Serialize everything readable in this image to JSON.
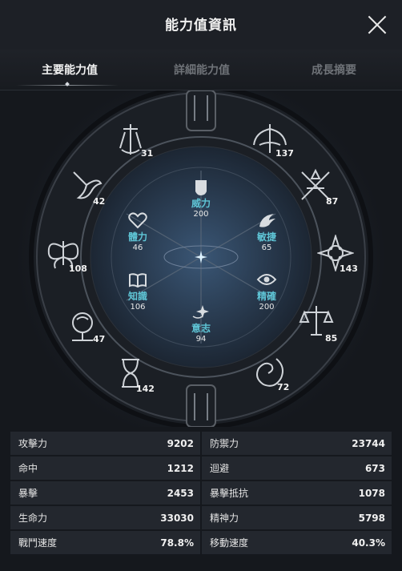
{
  "header": {
    "title": "能力值資訊"
  },
  "tabs": [
    {
      "label": "主要能力值",
      "active": true
    },
    {
      "label": "詳細能力值",
      "active": false
    },
    {
      "label": "成長摘要",
      "active": false
    }
  ],
  "wheel": {
    "outer": [
      {
        "icon": "sword-shield-icon",
        "value": "31"
      },
      {
        "icon": "winged-blade-icon",
        "value": "137"
      },
      {
        "icon": "phoenix-icon",
        "value": "42"
      },
      {
        "icon": "crossed-weapons-icon",
        "value": "87"
      },
      {
        "icon": "butterfly-icon",
        "value": "108"
      },
      {
        "icon": "star-compass-icon",
        "value": "143"
      },
      {
        "icon": "tree-icon",
        "value": "47"
      },
      {
        "icon": "scales-icon",
        "value": "85"
      },
      {
        "icon": "hourglass-icon",
        "value": "142"
      },
      {
        "icon": "swirl-icon",
        "value": "72"
      }
    ],
    "inner": [
      {
        "icon": "fist-icon",
        "label": "威力",
        "value": "200"
      },
      {
        "icon": "heart-icon",
        "label": "體力",
        "value": "46"
      },
      {
        "icon": "wing-icon",
        "label": "敏捷",
        "value": "65"
      },
      {
        "icon": "book-icon",
        "label": "知識",
        "value": "106"
      },
      {
        "icon": "eye-icon",
        "label": "精確",
        "value": "200"
      },
      {
        "icon": "shooting-star-icon",
        "label": "意志",
        "value": "94"
      }
    ]
  },
  "stats": [
    [
      {
        "label": "攻擊力",
        "value": "9202"
      },
      {
        "label": "防禦力",
        "value": "23744"
      }
    ],
    [
      {
        "label": "命中",
        "value": "1212"
      },
      {
        "label": "迴避",
        "value": "673"
      }
    ],
    [
      {
        "label": "暴擊",
        "value": "2453"
      },
      {
        "label": "暴擊抵抗",
        "value": "1078"
      }
    ],
    [
      {
        "label": "生命力",
        "value": "33030"
      },
      {
        "label": "精神力",
        "value": "5798"
      }
    ],
    [
      {
        "label": "戰鬥速度",
        "value": "78.8%"
      },
      {
        "label": "移動速度",
        "value": "40.3%"
      }
    ]
  ]
}
